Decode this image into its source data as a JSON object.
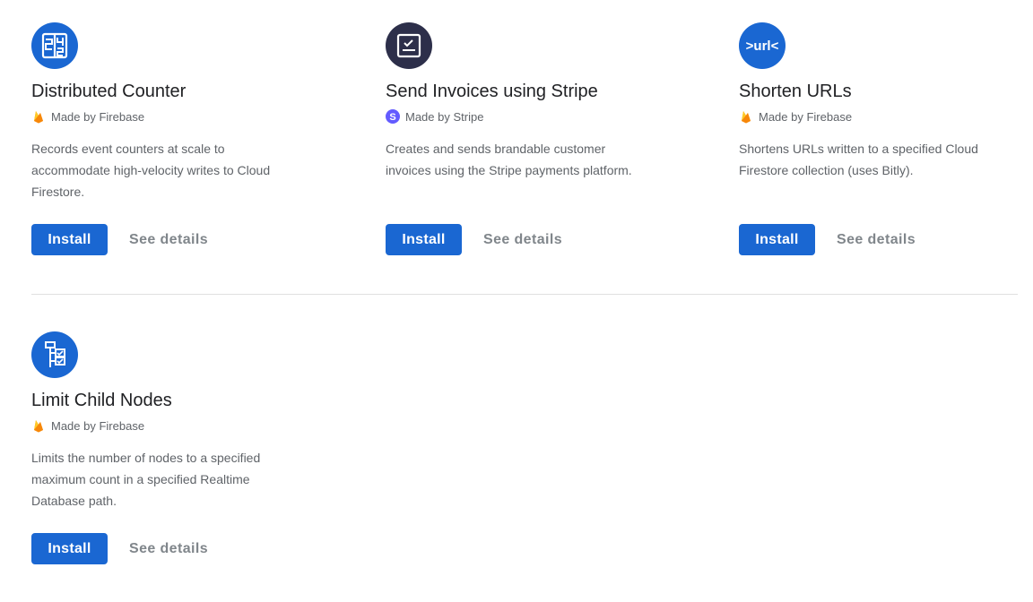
{
  "colors": {
    "primary": "#1a67d2",
    "stripe_icon_bg": "#2d2f4a",
    "stripe_badge": "#635bff",
    "firebase_yellow": "#ffca28",
    "firebase_orange": "#f57c00"
  },
  "extensions": [
    {
      "title": "Distributed Counter",
      "icon": "counter-icon",
      "maker": "Made by Firebase",
      "maker_icon": "firebase-flame-icon",
      "description": "Records event counters at scale to accommodate high-velocity writes to Cloud Firestore.",
      "install_label": "Install",
      "details_label": "See details"
    },
    {
      "title": "Send Invoices using Stripe",
      "icon": "invoice-icon",
      "maker": "Made by Stripe",
      "maker_icon": "stripe-s-icon",
      "description": "Creates and sends brandable customer invoices using the Stripe payments platform.",
      "install_label": "Install",
      "details_label": "See details"
    },
    {
      "title": "Shorten URLs",
      "icon": "url-icon",
      "icon_text": ">url<",
      "maker": "Made by Firebase",
      "maker_icon": "firebase-flame-icon",
      "description": "Shortens URLs written to a specified Cloud Firestore collection (uses Bitly).",
      "install_label": "Install",
      "details_label": "See details"
    },
    {
      "title": "Limit Child Nodes",
      "icon": "child-nodes-icon",
      "maker": "Made by Firebase",
      "maker_icon": "firebase-flame-icon",
      "description": "Limits the number of nodes to a specified maximum count in a specified Realtime Database path.",
      "install_label": "Install",
      "details_label": "See details"
    }
  ]
}
